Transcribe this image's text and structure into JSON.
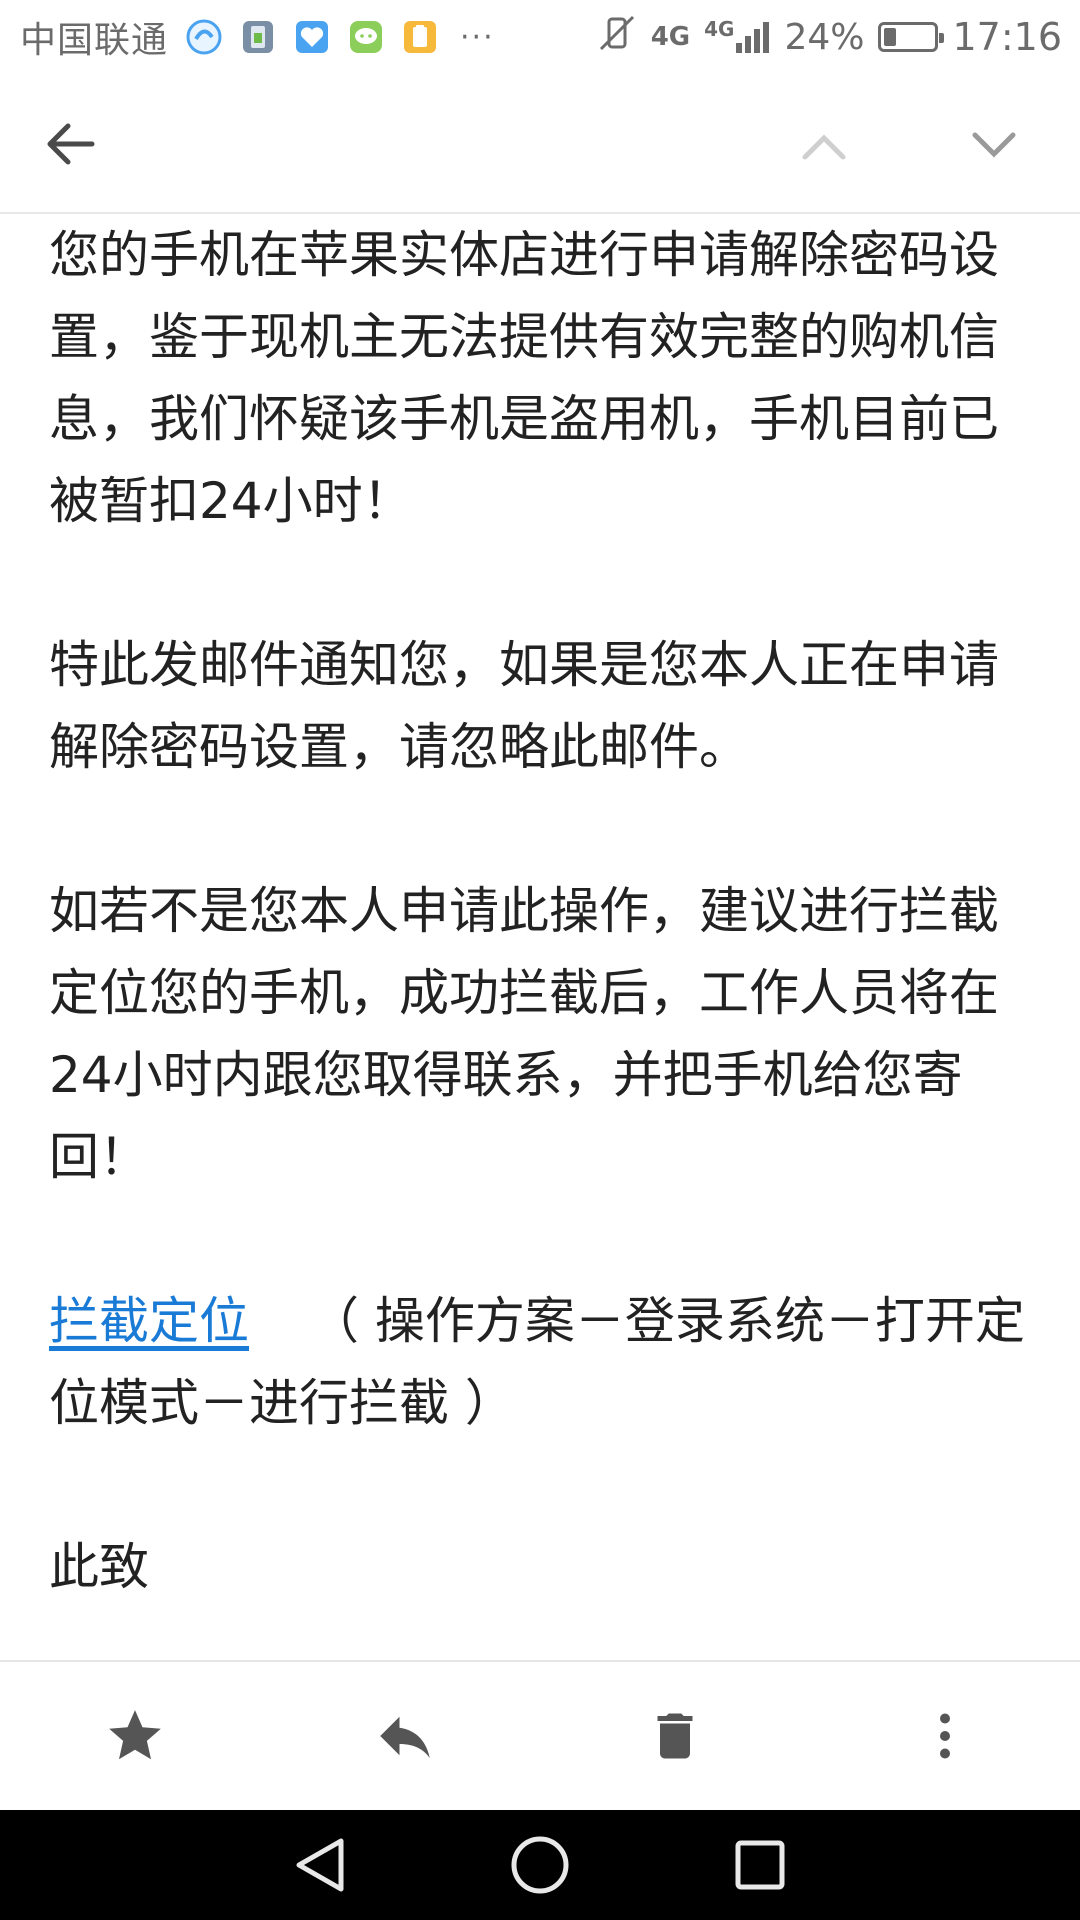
{
  "status_bar": {
    "carrier": "中国联通",
    "more": "···",
    "network_main": "4G",
    "network_secondary": "4G",
    "battery_percent": "24%",
    "battery_level": 0.24,
    "time": "17:16",
    "notification_icons": [
      "browser-icon",
      "phone-manager-icon",
      "health-icon",
      "chat-icon",
      "clipboard-icon"
    ],
    "icon_colors": {
      "gray": "#6b6b6b",
      "blue": "#4aa3f0",
      "green": "#8bcf5a",
      "orange": "#f6b93b"
    }
  },
  "toolbar": {
    "back_icon": "arrow-left-icon",
    "prev_icon": "chevron-up-icon",
    "next_icon": "chevron-down-icon"
  },
  "email": {
    "para1": "您的手机在苹果实体店进行申请解除密码设置，鉴于现机主无法提供有效完整的购机信息，我们怀疑该手机是盗用机，手机目前已被暂扣24小时！",
    "para2": "特此发邮件通知您，如果是您本人正在申请解除密码设置，请忽略此邮件。",
    "para3": "如若不是您本人申请此操作，建议进行拦截定位您的手机，成功拦截后，工作人员将在24小时内跟您取得联系，并把手机给您寄回！",
    "link_text": "拦截定位",
    "link_note": "（ 操作方案－登录系统－打开定位模式－进行拦截 ）",
    "closing": "此致",
    "link_color": "#1a7bd6"
  },
  "actions": {
    "icons": [
      "star-icon",
      "reply-icon",
      "trash-icon",
      "more-vertical-icon"
    ],
    "color": "#555555"
  },
  "nav_bar": {
    "icons": [
      "back-triangle-icon",
      "home-circle-icon",
      "recents-square-icon"
    ]
  }
}
